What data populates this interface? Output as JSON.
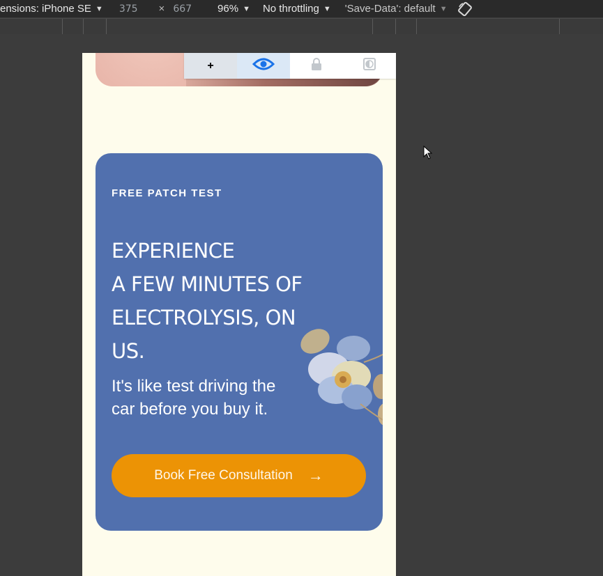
{
  "devtools": {
    "device_label": "ensions: iPhone SE",
    "width_value": "375",
    "times_symbol": "×",
    "height_value": "667",
    "zoom": "96%",
    "throttling": "No throttling",
    "save_data": "'Save-Data': default"
  },
  "a11y_toolbar": {
    "plus_label": "+"
  },
  "card": {
    "eyebrow": "FREE PATCH TEST",
    "headline_lines": [
      "EXPERIENCE",
      "A FEW MINUTES OF",
      "ELECTROLYSIS, ON",
      "US."
    ],
    "subtext": "It's like test driving the car before you buy it.",
    "cta_label": "Book Free Consultation",
    "cta_arrow": "→"
  },
  "colors": {
    "card_bg": "#5170ae",
    "cta_bg": "#ec9305",
    "page_bg": "#fefcec"
  }
}
